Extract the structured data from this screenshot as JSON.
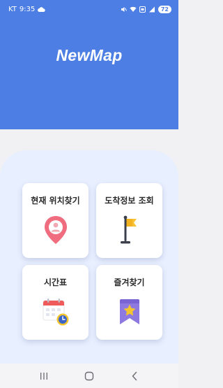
{
  "status_bar": {
    "carrier": "KT",
    "time": "9:35",
    "battery": "72"
  },
  "app": {
    "title": "NewMap"
  },
  "menu": [
    {
      "label": "현재 위치찾기",
      "icon": "location-pin-icon"
    },
    {
      "label": "도착정보 조회",
      "icon": "flag-icon"
    },
    {
      "label": "시간표",
      "icon": "calendar-clock-icon"
    },
    {
      "label": "즐겨찾기",
      "icon": "bookmark-star-icon"
    }
  ],
  "nav": {
    "recents": "recents-icon",
    "home": "home-icon",
    "back": "back-icon"
  },
  "colors": {
    "primary": "#4d7ee3",
    "panel": "#e8efff",
    "background": "#f1f1f3"
  }
}
